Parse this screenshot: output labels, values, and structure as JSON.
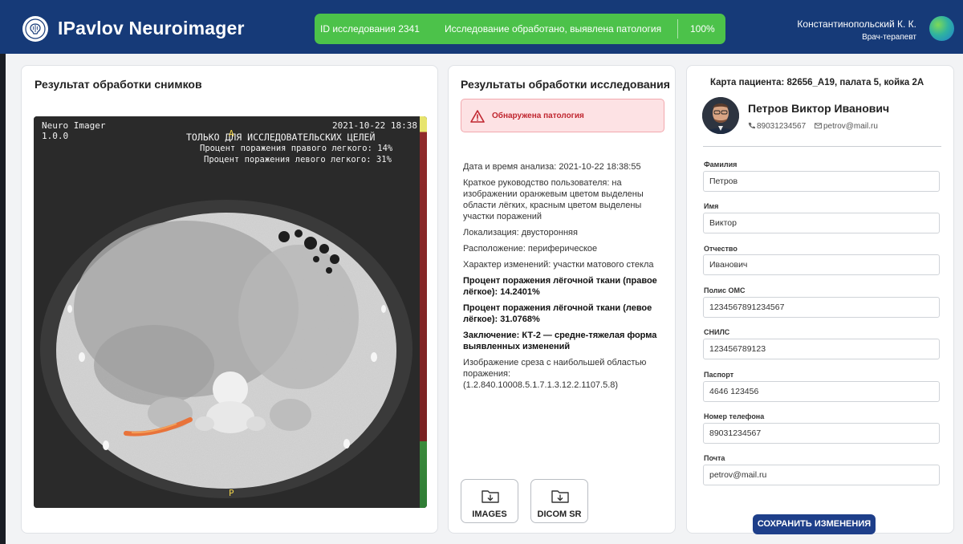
{
  "header": {
    "app_title": "IPavlov Neuroimager",
    "study_id": "ID исследования 2341",
    "status_message": "Исследование обработано, выявлена патология",
    "progress": "100%",
    "progress_value": 100,
    "user_name": "Константинопольский К. К.",
    "user_role": "Врач-терапевт"
  },
  "left_panel": {
    "title": "Результат обработки снимков",
    "ct": {
      "brand_line1": "Neuro Imager",
      "brand_line2": "1.0.0",
      "date": "2021-10-22 18:38",
      "research_note": "ТОЛЬКО ДЛЯ ИССЛЕДОВАТЕЛЬСКИХ ЦЕЛЕЙ",
      "right_lung": "Процент поражения правого легкого: 14%",
      "left_lung": "Процент поражения левого легкого: 31%",
      "marker_top": "A",
      "marker_bottom": "P"
    }
  },
  "mid_panel": {
    "title": "Результаты обработки исследования",
    "alert": "Обнаружена патология",
    "date_time": "Дата и время анализа: 2021-10-22 18:38:55",
    "guide": "Краткое руководство пользователя: на изображении оранжевым цветом выделены области лёгких, красным цветом выделены участки поражений",
    "localization": "Локализация: двусторонняя",
    "location": "Расположение: периферическое",
    "changes": "Характер изменений: участки матового стекла",
    "right_percent": "Процент поражения лёгочной ткани (правое лёгкое): 14.2401%",
    "left_percent": "Процент поражения лёгочной ткани (левое лёгкое): 31.0768%",
    "conclusion": "Заключение: КТ-2 — средне-тяжелая форма выявленных изменений",
    "slice": "Изображение среза с наибольшей областью поражения: (1.2.840.10008.5.1.7.1.3.12.2.1107.5.8)",
    "btn_images": "IMAGES",
    "btn_dicom": "DICOM SR"
  },
  "right_panel": {
    "card_title": "Карта пациента: 82656_A19, палата 5, койка 2А",
    "patient_name": "Петров Виктор Иванович",
    "phone": "89031234567",
    "email": "petrov@mail.ru",
    "fields": {
      "surname_label": "Фамилия",
      "surname": "Петров",
      "name_label": "Имя",
      "name": "Виктор",
      "patronymic_label": "Отчество",
      "patronymic": "Иванович",
      "oms_label": "Полис ОМС",
      "oms": "1234567891234567",
      "snils_label": "СНИЛС",
      "snils": "123456789123",
      "passport_label": "Паспорт",
      "passport": "4646 123456",
      "phone_label": "Номер телефона",
      "phone": "89031234567",
      "email_label": "Почта",
      "email": "petrov@mail.ru"
    },
    "save_button": "СОХРАНИТЬ ИЗМЕНЕНИЯ"
  },
  "colors": {
    "header_bg": "#163a78",
    "status_green": "#4cc24a",
    "alert_red": "#c0262f",
    "save_blue": "#1e3f8a"
  }
}
